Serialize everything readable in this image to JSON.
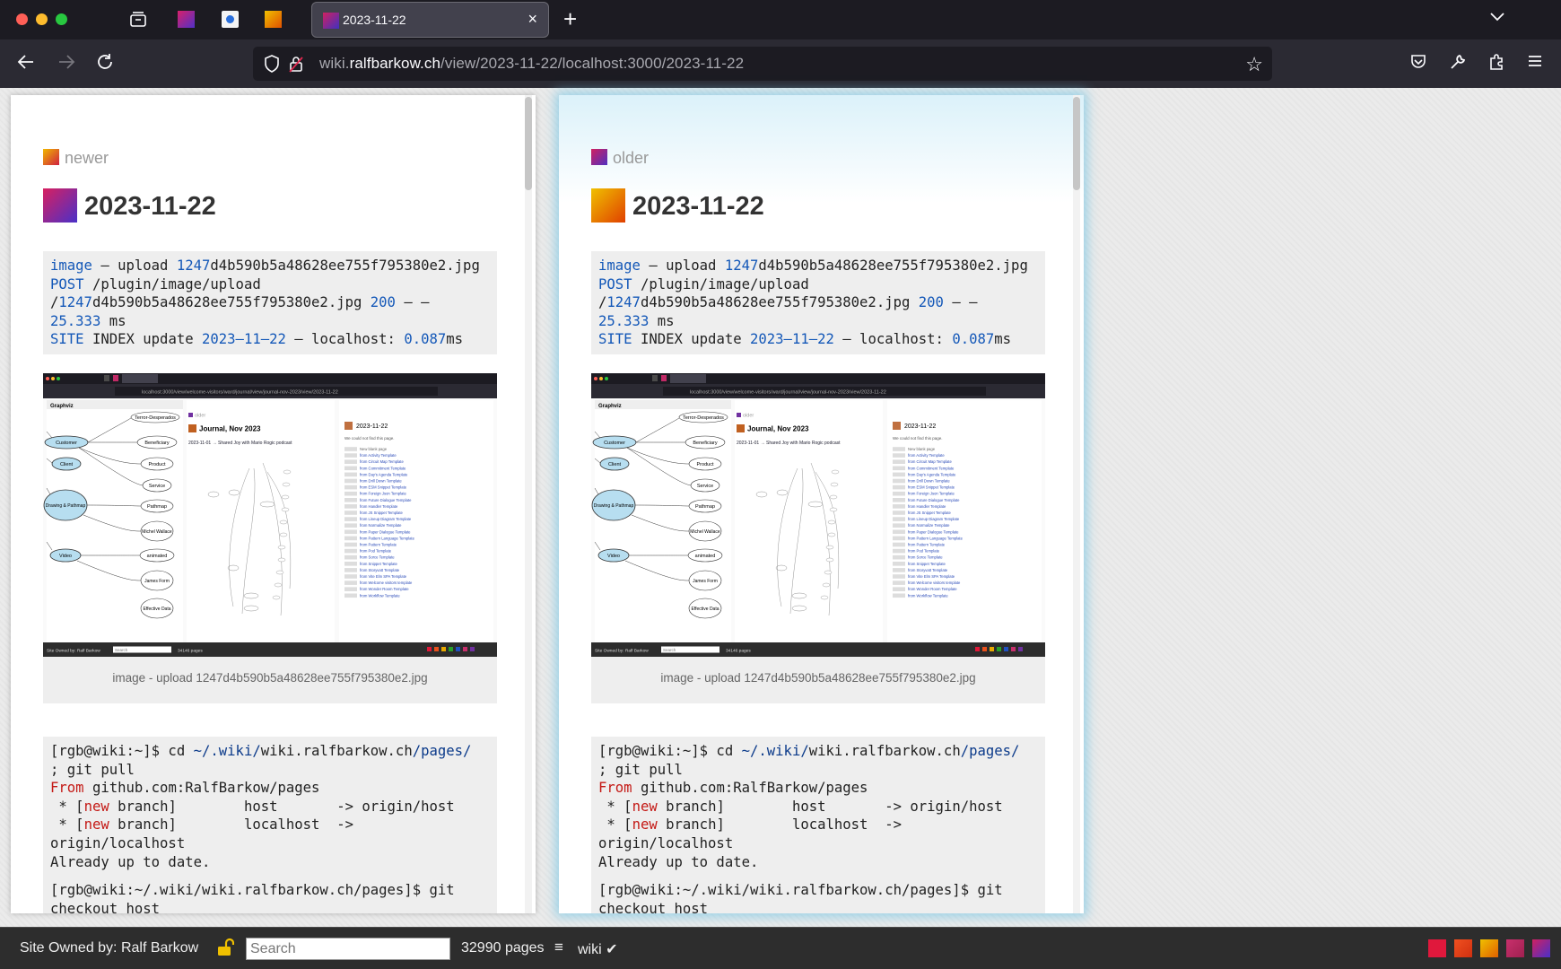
{
  "browser": {
    "tab_title": "2023-11-22",
    "url_prefix": "wiki.",
    "url_host": "ralfbarkow.ch",
    "url_path": "/view/2023-11-22/localhost:3000/2023-11-22"
  },
  "pages": [
    {
      "twin_label": "newer",
      "twin_color": "#e8a000",
      "title": "2023-11-22",
      "caption": "image - upload 1247d4b590b5a48628ee755f795380e2.jpg"
    },
    {
      "twin_label": "older",
      "twin_color": "#7030a0",
      "title": "2023-11-22",
      "caption": "image - upload 1247d4b590b5a48628ee755f795380e2.jpg"
    }
  ],
  "log": {
    "l1_a": "image",
    "l1_b": " – upload ",
    "l1_c": "1247",
    "l1_d": "d4b590b5a48628ee755f795380e2.jpg",
    "l2_a": "POST",
    "l2_b": " /plugin/image/upload",
    "l3_a": "/",
    "l3_b": "1247",
    "l3_c": "d4b590b5a48628ee755f795380e2.jpg ",
    "l3_d": "200",
    "l3_e": " – –",
    "l4_a": "25.333",
    "l4_b": " ms",
    "l5_a": "SITE",
    "l5_b": " INDEX update ",
    "l5_c": "2023–11–22",
    "l5_d": " – localhost: ",
    "l5_e": "0.087",
    "l5_f": "ms"
  },
  "git_pull": {
    "l1_a": "[rgb@wiki:~]$ cd ",
    "l1_b": "~/.wiki/",
    "l1_c": "wiki.ralfbarkow.ch",
    "l1_d": "/pages/",
    "l2": "; git pull",
    "l3_a": "From",
    "l3_b": " github.com:RalfBarkow/pages",
    "l4_a": " * [",
    "l4_b": "new",
    "l4_c": " branch]        host       -> origin/host",
    "l5_a": " * [",
    "l5_b": "new",
    "l5_c": " branch]        localhost  ->",
    "l6": "origin/localhost",
    "l7": "Already up to date."
  },
  "git_checkout": {
    "l1": "[rgb@wiki:~/.wiki/wiki.ralfbarkow.ch/pages]$ git",
    "l2": "checkout host"
  },
  "screenshot": {
    "graph_tab": "Graphviz",
    "nodes": [
      "Terror-Desperados",
      "Customer",
      "Beneficiary",
      "Client",
      "Product",
      "Service",
      "Drawing & Pathmap",
      "Pathmap",
      "Michel Wallace",
      "Video",
      "animated",
      "James Form",
      "Effective Data"
    ],
    "page2_twin": "older",
    "page2_title": "Journal, Nov 2023",
    "page2_text": "2023-11-01 → Shared Joy with Mario Rogic podcast",
    "page3_title": "2023-11-22",
    "page3_text": "We could not find this page.",
    "templates": [
      "New blank page",
      "from Activity Template",
      "from Circuit Map Template",
      "from Commitment Template",
      "from Day's Agenda Template",
      "from Drill Down Template",
      "from ESM Snippet Template",
      "from Foreign Json Template",
      "from Future Dialogue Template",
      "from Handler Template",
      "from JS Snippet Template",
      "from Lineup Diagram Template",
      "from Normalize Template",
      "from Paper Dialogue Template",
      "from Pattern Language Template",
      "from Pattern Template",
      "from Pod Template",
      "from Sorce Template",
      "from Snippet Template",
      "from Storyvatt Template",
      "from Vite Elm SPA Template",
      "from Welcome visitors template",
      "from Wonder Room Template",
      "from Workflow Template"
    ],
    "footer_owner": "Site Owned by: Ralf Barkow",
    "footer_search": "Search",
    "footer_count": "34146 pages"
  },
  "footer": {
    "owner": "Site Owned by: Ralf Barkow",
    "search_placeholder": "Search",
    "page_count": "32990 pages",
    "menu_icon": "≡",
    "wiki_label": "wiki ✔"
  },
  "colors": {
    "link_blue": "#1458b8",
    "string_red": "#c41a16",
    "neighbors": [
      "#e0183c",
      "#e8501c",
      "#e8a800",
      "#c8306c",
      "#7030a0"
    ]
  }
}
